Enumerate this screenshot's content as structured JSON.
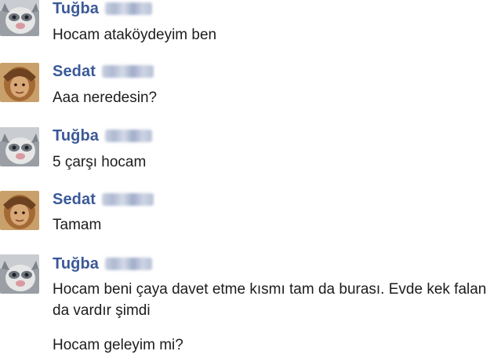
{
  "conversation": {
    "messages": [
      {
        "sender": "Tuğba",
        "avatar": "cat-avatar",
        "lines": [
          "Hocam ataköydeyim ben"
        ]
      },
      {
        "sender": "Sedat",
        "avatar": "person-avatar",
        "lines": [
          "Aaa neredesin?"
        ]
      },
      {
        "sender": "Tuğba",
        "avatar": "cat-avatar",
        "lines": [
          "5 çarşı hocam"
        ]
      },
      {
        "sender": "Sedat",
        "avatar": "person-avatar",
        "lines": [
          "Tamam"
        ]
      },
      {
        "sender": "Tuğba",
        "avatar": "cat-avatar",
        "lines": [
          "Hocam beni çaya davet etme kısmı tam da burası. Evde kek falan da vardır şimdi",
          "Hocam geleyim mi?"
        ]
      }
    ]
  },
  "colors": {
    "sender_name": "#3b5998",
    "message_text": "#1c1c1c",
    "background": "#ffffff",
    "redaction_blur": "#aab5cf"
  }
}
